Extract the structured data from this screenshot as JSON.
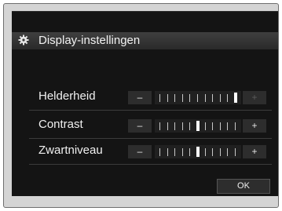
{
  "dialog": {
    "title": "Display-instellingen",
    "icon": "gear-icon"
  },
  "rows": [
    {
      "label": "Helderheid",
      "minus": "–",
      "plus": "+",
      "level": 10,
      "max": 10,
      "plus_enabled": false
    },
    {
      "label": "Contrast",
      "minus": "–",
      "plus": "+",
      "level": 5,
      "max": 10,
      "plus_enabled": true
    },
    {
      "label": "Zwartniveau",
      "minus": "–",
      "plus": "+",
      "level": 5,
      "max": 10,
      "plus_enabled": true
    }
  ],
  "ok_label": "OK"
}
